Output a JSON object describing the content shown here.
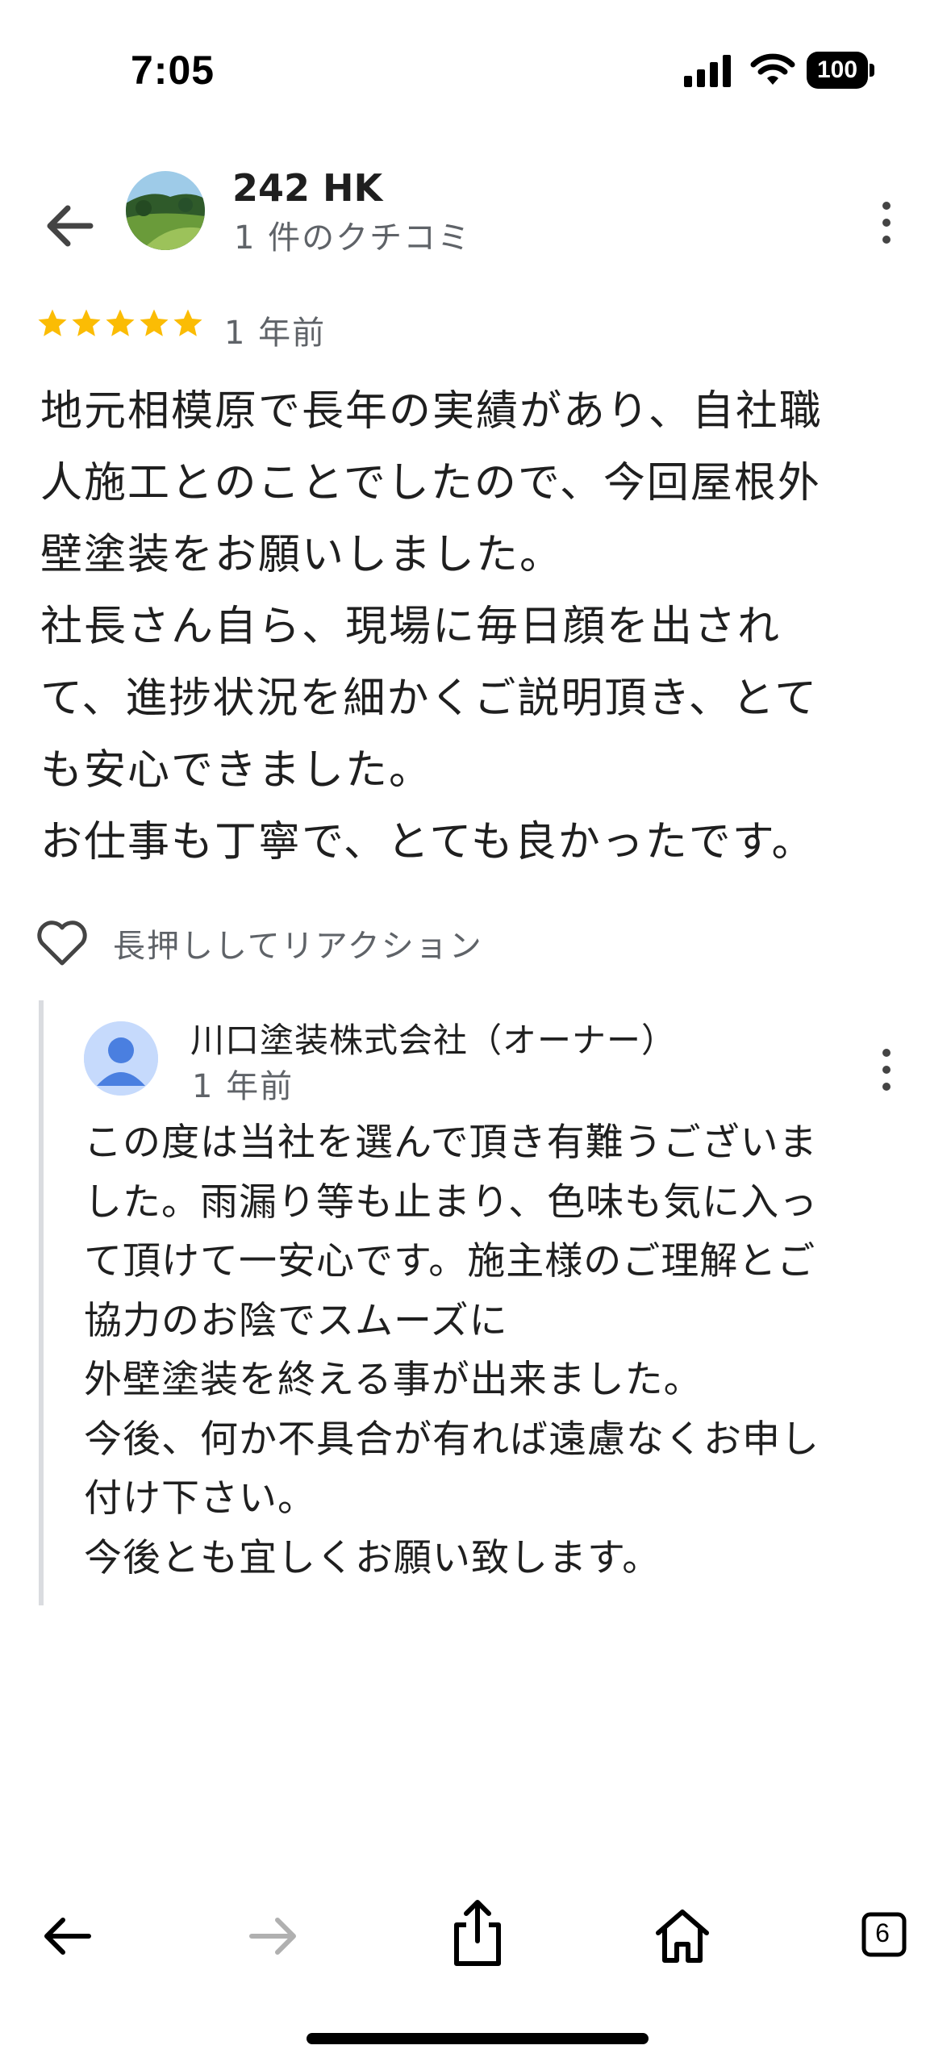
{
  "status_bar": {
    "time": "7:05",
    "battery_percent": "100",
    "icons": [
      "signal-icon",
      "wifi-icon",
      "battery-icon"
    ]
  },
  "header": {
    "reviewer_name": "242 HK",
    "review_count": "1 件のクチコミ",
    "icons": [
      "back-arrow-icon",
      "more-vert-icon"
    ]
  },
  "review": {
    "rating": 5,
    "rating_max": 5,
    "star_color": "#fbbc04",
    "date": "1 年前",
    "text": "地元相模原で長年の実績があり、自社職\n人施工とのことでしたので、今回屋根外\n壁塗装をお願いしました。\n社長さん自ら、現場に毎日顔を出され\nて、進捗状況を細かくご説明頂き、とて\nも安心できました。\nお仕事も丁寧で、とても良かったです。"
  },
  "reaction": {
    "label": "長押ししてリアクション",
    "icon": "heart-outline-icon"
  },
  "owner_reply": {
    "name": "川口塗装株式会社（オーナー）",
    "date": "1 年前",
    "text": "この度は当社を選んで頂き有難うございま\nした。雨漏り等も止まり、色味も気に入っ\nて頂けて一安心です。施主様のご理解とご\n協力のお陰でスムーズに\n外壁塗装を終える事が出来ました。\n今後、何か不具合が有れば遠慮なくお申し\n付け下さい。\n今後とも宜しくお願い致します。",
    "avatar_color": "#4a7fe0"
  },
  "browser_toolbar": {
    "tabs_count": "6",
    "icons": [
      "back-icon",
      "forward-icon",
      "share-icon",
      "home-icon",
      "tabs-icon"
    ]
  }
}
